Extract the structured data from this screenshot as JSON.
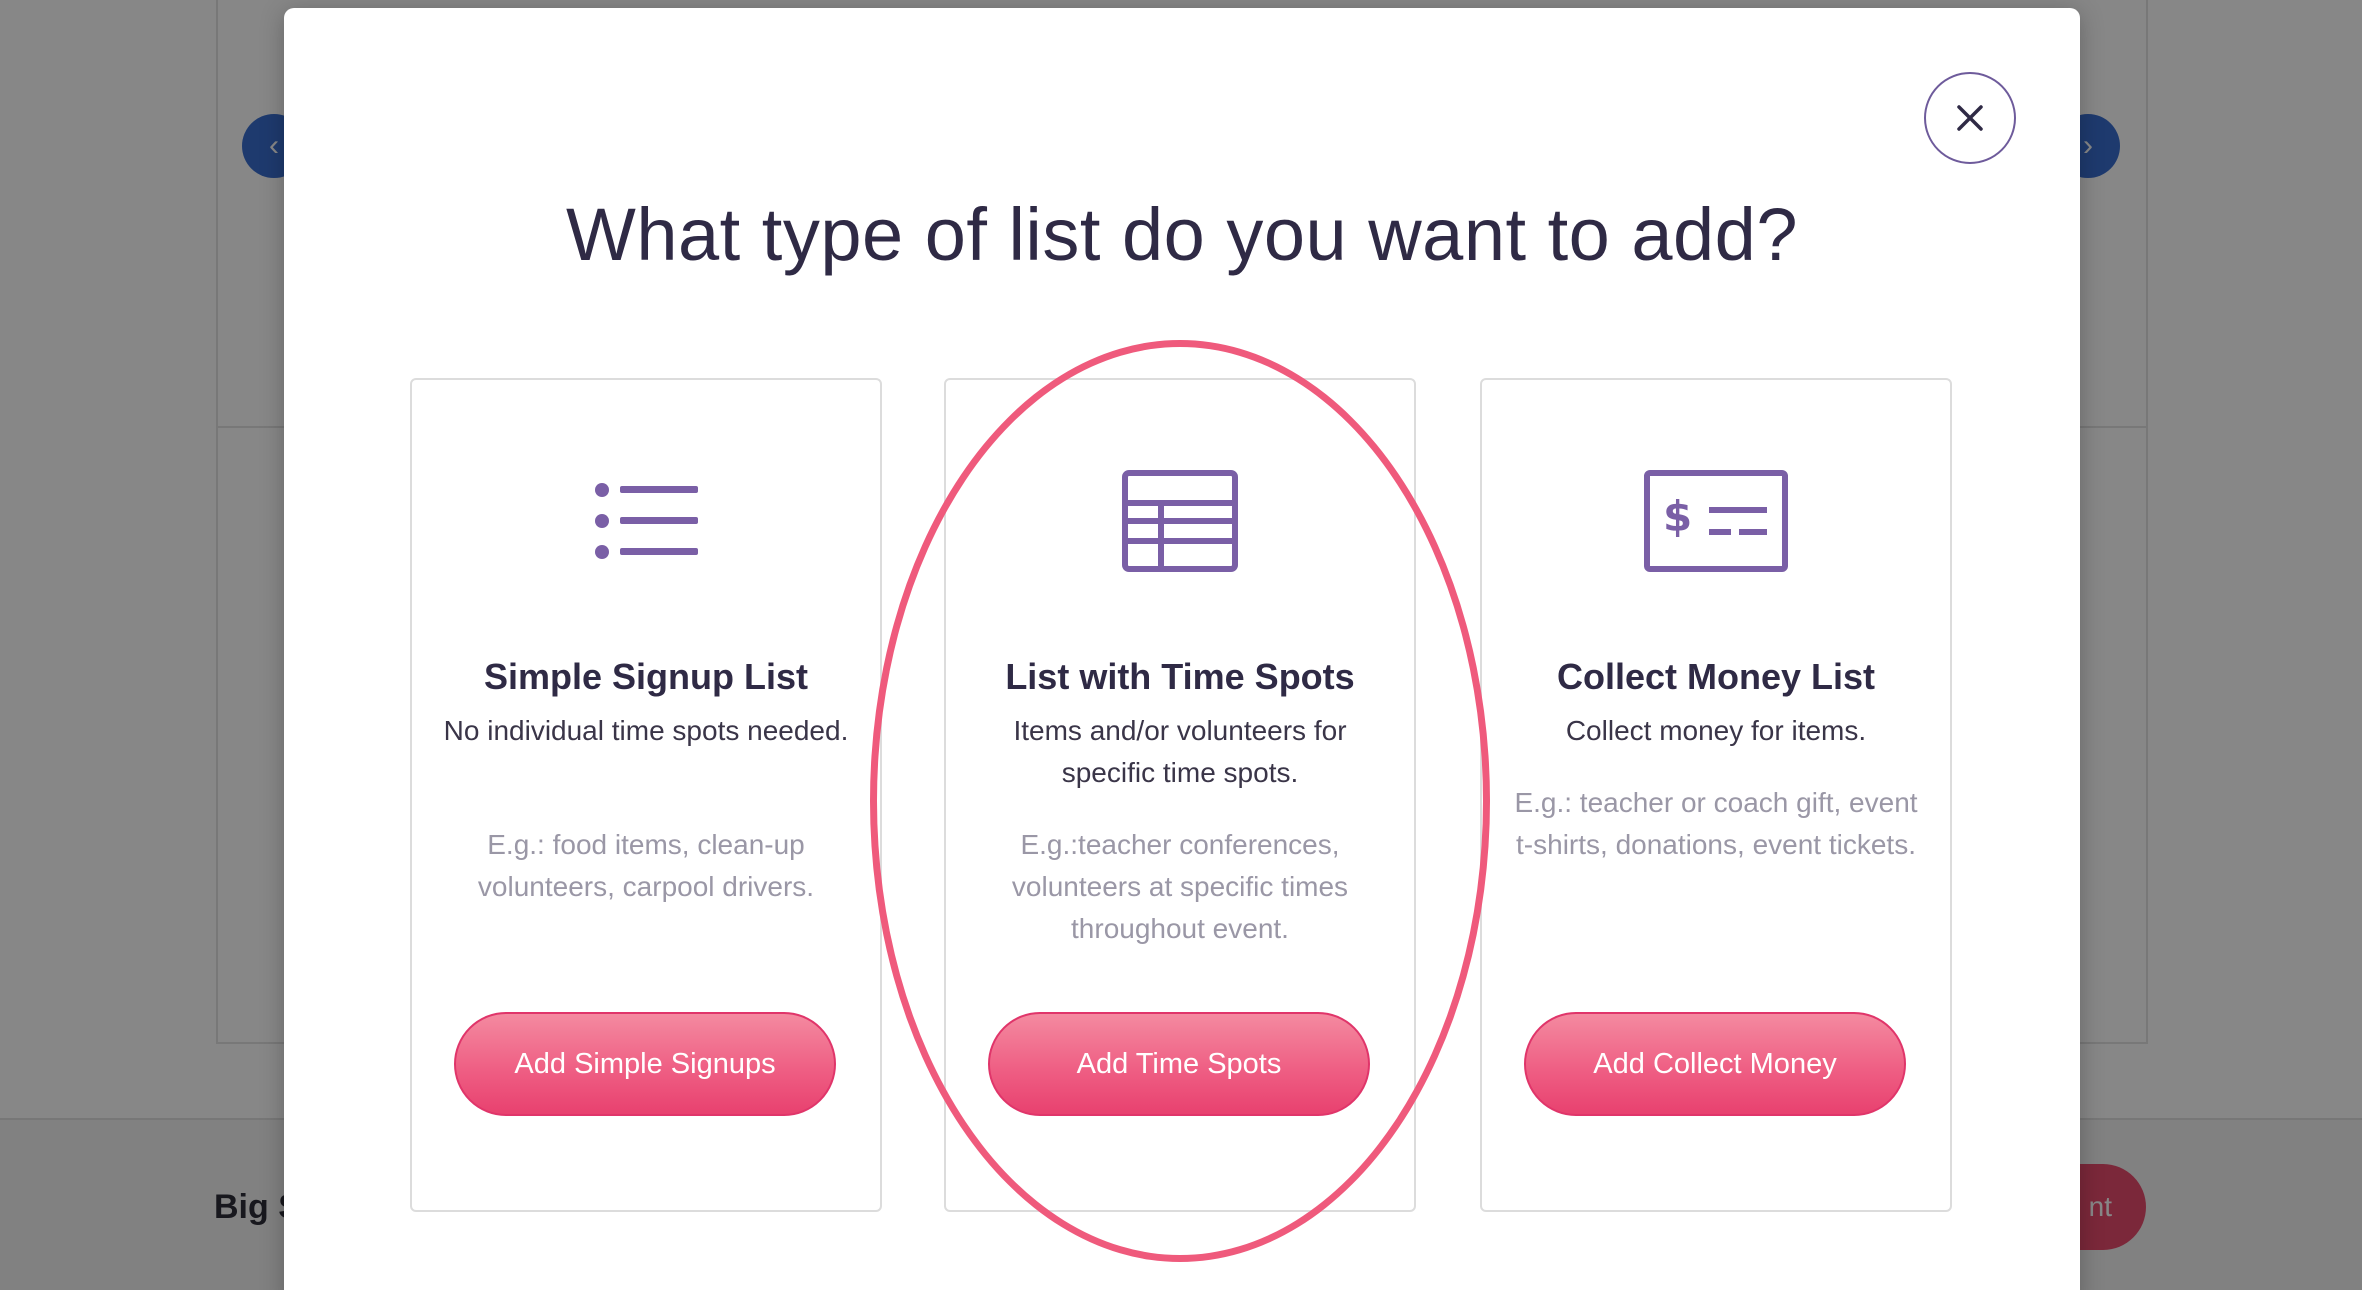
{
  "background": {
    "footer_text": "Big S",
    "footer_button_label": "nt",
    "prev_arrow": "‹",
    "next_arrow": "›"
  },
  "modal": {
    "title": "What type of list do you want to add?",
    "close_label": "Close",
    "cards": [
      {
        "icon": "list-icon",
        "title": "Simple Signup List",
        "description": "No individual time spots needed.",
        "example": "E.g.: food items, clean-up volunteers, carpool drivers.",
        "button_label": "Add Simple Signups"
      },
      {
        "icon": "table-icon",
        "title": "List with Time Spots",
        "description": "Items and/or volunteers for specific time spots.",
        "example": "E.g.:teacher conferences, volunteers at specific times throughout event.",
        "button_label": "Add Time Spots"
      },
      {
        "icon": "money-card-icon",
        "title": "Collect Money List",
        "description": "Collect money for items.",
        "example": "E.g.: teacher or coach gift, event t-shirts, donations, event tickets.",
        "button_label": "Add Collect Money"
      }
    ]
  },
  "colors": {
    "accent": "#6e5b9b",
    "button": "#ef5f84",
    "highlight": "#ef5a7c",
    "title_text": "#2f2a45"
  }
}
